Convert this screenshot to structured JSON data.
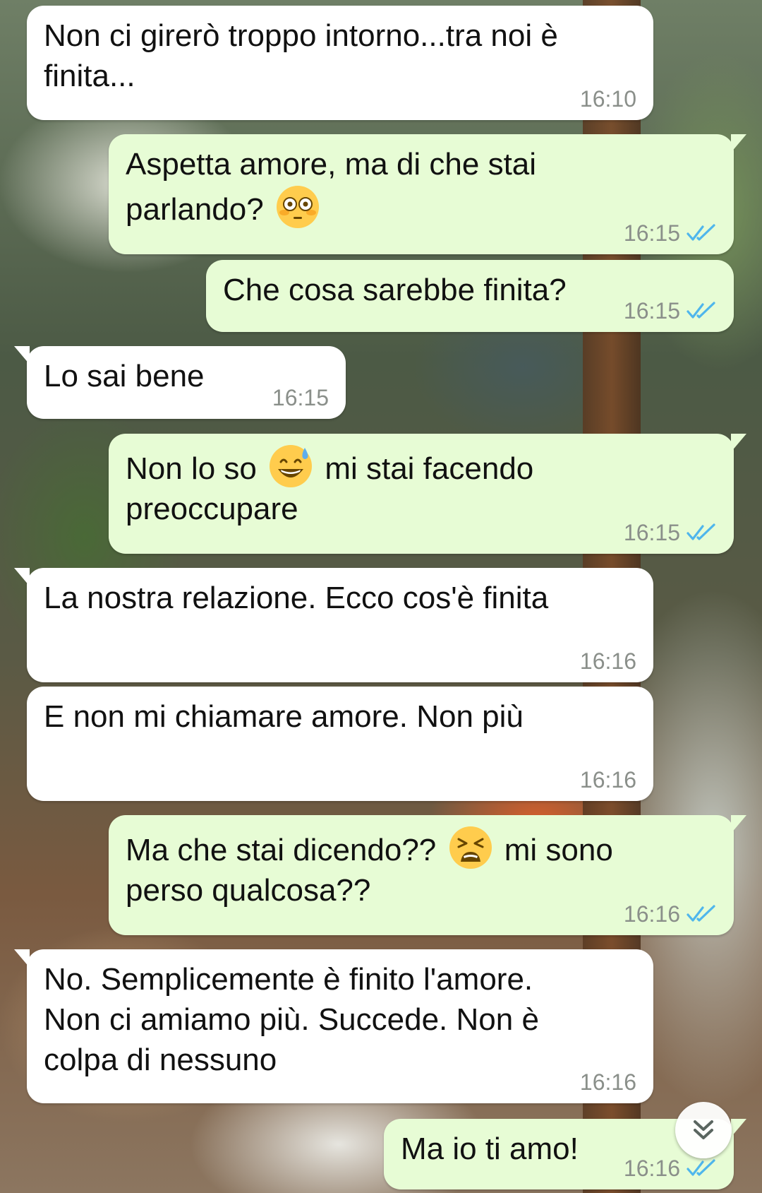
{
  "messages": [
    {
      "lines": [
        "Non ci girerò troppo intorno...tra noi è",
        "finita..."
      ],
      "time": "16:10"
    },
    {
      "lines": [
        "Aspetta amore, ma di che stai",
        "parlando? "
      ],
      "time": "16:15",
      "emoji": "flushed-face"
    },
    {
      "lines": [
        "Che cosa sarebbe finita?"
      ],
      "time": "16:15"
    },
    {
      "lines": [
        "Lo sai bene"
      ],
      "time": "16:15"
    },
    {
      "lines": [
        "Non lo so ",
        " mi stai facendo",
        "preoccupare"
      ],
      "time": "16:15",
      "emoji": "grinning-face-with-sweat"
    },
    {
      "lines": [
        "La nostra relazione. Ecco cos'è finita"
      ],
      "time": "16:16"
    },
    {
      "lines": [
        "E non mi chiamare amore. Non più"
      ],
      "time": "16:16"
    },
    {
      "lines": [
        "Ma che stai dicendo?? ",
        " mi sono",
        "perso qualcosa??"
      ],
      "time": "16:16",
      "emoji": "tired-face"
    },
    {
      "lines": [
        "No. Semplicemente è finito l'amore.",
        "Non ci amiamo più. Succede. Non è",
        "colpa di nessuno"
      ],
      "time": "16:16"
    },
    {
      "lines": [
        "Ma io ti amo!"
      ],
      "time": "16:16"
    }
  ],
  "colors": {
    "incoming_bubble": "#ffffff",
    "outgoing_bubble": "#e7fcd5",
    "read_ticks": "#4fb6ec",
    "timestamp": "#8a8f8a"
  },
  "icons": {
    "read_status": "double-check-icon",
    "scroll_down": "double-chevron-down-icon"
  }
}
